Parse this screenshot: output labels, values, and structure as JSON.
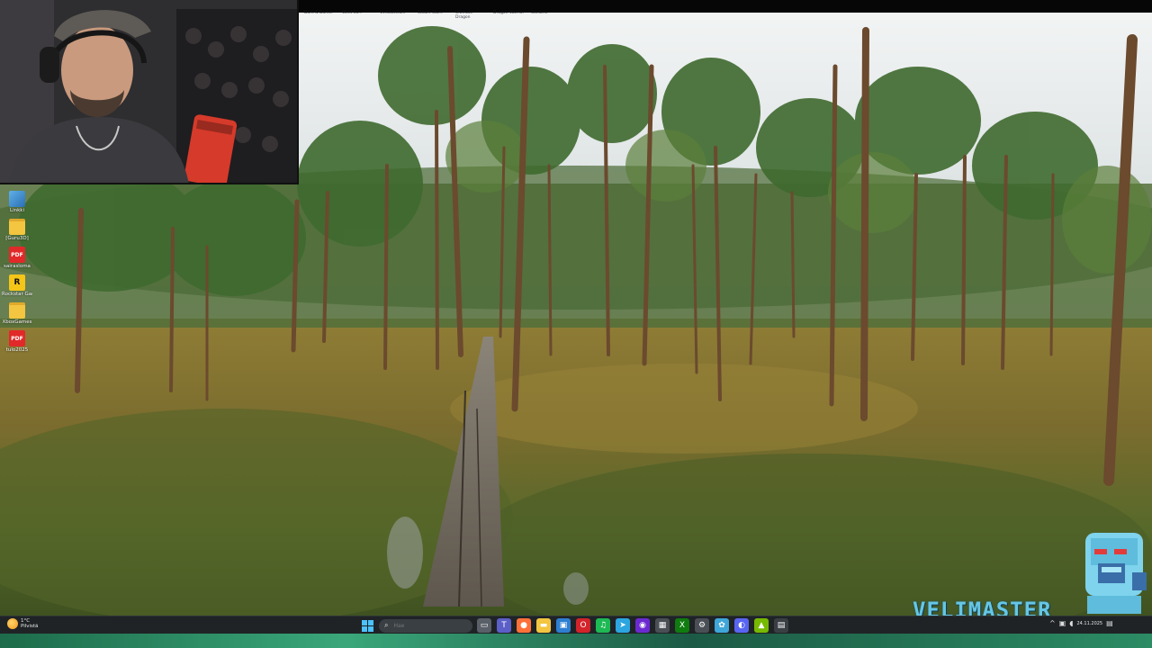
{
  "browser_tabs": [
    {
      "label": "Dark & Darker"
    },
    {
      "label": "Weld Co..."
    },
    {
      "label": "Verkkoselain"
    },
    {
      "label": "Steam Store"
    },
    {
      "label": "Ultimate Dragon"
    },
    {
      "label": "Dragon Warrior"
    },
    {
      "label": "Stellaris"
    }
  ],
  "desktop_icons": [
    {
      "label": "Linkki",
      "icon": "app-icon",
      "kind": "app"
    },
    {
      "label": "[Guru3D]",
      "icon": "folder-icon",
      "kind": "folder"
    },
    {
      "label": "sairasloma",
      "icon": "pdf-icon",
      "kind": "pdf",
      "badge": "PDF"
    },
    {
      "label": "Rockstar Games",
      "icon": "rockstar-icon",
      "kind": "rock",
      "badge": "R"
    },
    {
      "label": "XboxGames",
      "icon": "folder-icon",
      "kind": "folder"
    },
    {
      "label": "tulo2025",
      "icon": "pdf-icon",
      "kind": "pdf",
      "badge": "PDF"
    }
  ],
  "weather": {
    "temp": "1°C",
    "condition": "Pilvistä",
    "icon": "weather-icon"
  },
  "search": {
    "placeholder": "Hae"
  },
  "taskbar_apps": [
    {
      "name": "task-view",
      "glyph": "▭",
      "color": "#5a6068"
    },
    {
      "name": "teams",
      "glyph": "T",
      "color": "#5b5fc7"
    },
    {
      "name": "firefox",
      "glyph": "●",
      "color": "#ff7139"
    },
    {
      "name": "file-explorer",
      "glyph": "▬",
      "color": "#f3c540"
    },
    {
      "name": "store",
      "glyph": "▣",
      "color": "#2d7fd1"
    },
    {
      "name": "opera",
      "glyph": "O",
      "color": "#d3232b"
    },
    {
      "name": "spotify",
      "glyph": "♫",
      "color": "#1db954"
    },
    {
      "name": "telegram",
      "glyph": "➤",
      "color": "#2ca5e0"
    },
    {
      "name": "obs",
      "glyph": "◉",
      "color": "#6b2ad0"
    },
    {
      "name": "app",
      "glyph": "▦",
      "color": "#4a4f56"
    },
    {
      "name": "xbox",
      "glyph": "X",
      "color": "#107c10"
    },
    {
      "name": "settings",
      "glyph": "⚙",
      "color": "#4a4f56"
    },
    {
      "name": "app2",
      "glyph": "✿",
      "color": "#3fa6d9"
    },
    {
      "name": "discord",
      "glyph": "◐",
      "color": "#5865f2"
    },
    {
      "name": "nvidia",
      "glyph": "▲",
      "color": "#76b900"
    },
    {
      "name": "app3",
      "glyph": "▤",
      "color": "#3a3f44"
    }
  ],
  "tray": {
    "chevron": "^",
    "date": "24.11.2025",
    "time": ""
  },
  "watermark": {
    "text": "VELIMASTER"
  },
  "colors": {
    "taskbar": "#1f2326",
    "brand": "#66c6e4"
  }
}
